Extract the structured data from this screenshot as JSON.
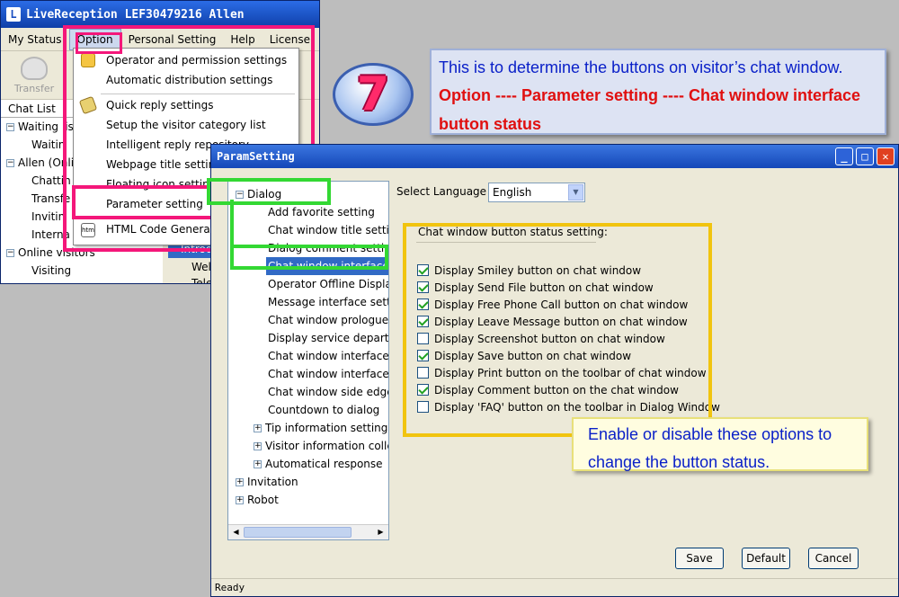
{
  "app": {
    "title": "LiveReception  LEF30479216 Allen",
    "logo": "L",
    "menu": [
      "My Status",
      "Option",
      "Personal Setting",
      "Help",
      "License"
    ],
    "toolbar": {
      "transfer_label": "Transfer"
    },
    "chat_list_header": "Chat List",
    "tree": [
      "Waiting lis",
      "Waitin",
      "Allen (Onli",
      "Chattin",
      "Transfe",
      "Invitin",
      "Interna",
      "Online visitors",
      "Visiting"
    ],
    "behind_tree": [
      "Introd",
      "Welco",
      "Telepho"
    ]
  },
  "option_menu": {
    "items": [
      "Operator and permission settings",
      "Automatic distribution settings",
      "Quick reply settings",
      "Setup the visitor category list",
      "Intelligent reply repository",
      "Webpage title settings",
      "Floating icon settings",
      "Parameter setting",
      "HTML Code Generator"
    ],
    "html_icon_text": "htm"
  },
  "callout_top": {
    "line1": "This is to determine the buttons on visitor’s chat window.",
    "line2": "Option ---- Parameter setting ---- Chat window interface",
    "line3": "button status"
  },
  "step_number": "7",
  "dialog": {
    "title": "ParamSetting",
    "tree": {
      "dialog": "Dialog",
      "children": [
        "Add favorite setting",
        "Chat window title setting",
        "Dialog comment setting",
        "Chat window interface bu",
        "Operator Offline Display in",
        "Message interface setting",
        "Chat window prologue se",
        "Display service departmen",
        "Chat window interface sk",
        "Chat window interface fo",
        "Chat window side edge a",
        "Countdown to dialog",
        "Tip information setting",
        "Visitor information collec",
        "Automatical response"
      ],
      "invitation": "Invitation",
      "robot": "Robot"
    },
    "language_label": "Select Language",
    "language_value": "English",
    "group_title": "Chat window button status setting:",
    "options": [
      {
        "label": "Display Smiley button on chat window",
        "checked": true
      },
      {
        "label": "Display Send File button on chat window",
        "checked": true
      },
      {
        "label": "Display Free Phone Call button on chat window",
        "checked": true
      },
      {
        "label": "Display Leave Message button on chat window",
        "checked": true
      },
      {
        "label": "Display Screenshot button on chat window",
        "checked": false
      },
      {
        "label": "Display Save button on chat window",
        "checked": true
      },
      {
        "label": "Display Print button on the toolbar of chat window",
        "checked": false
      },
      {
        "label": "Display Comment button on the chat window",
        "checked": true
      },
      {
        "label": "Display 'FAQ' button on the toolbar in Dialog Window",
        "checked": false
      }
    ],
    "buttons": {
      "save": "Save",
      "default": "Default",
      "cancel": "Cancel"
    },
    "status": "Ready"
  },
  "callout_bottom": {
    "line1": "Enable or disable these options to",
    "line2": "change the button status."
  },
  "colors": {
    "highlight_pink": "#f4177a",
    "highlight_green": "#33d833",
    "highlight_yellow": "#f1c40f",
    "callout_blue_text": "#0a20c8",
    "callout_red_text": "#e01010"
  }
}
